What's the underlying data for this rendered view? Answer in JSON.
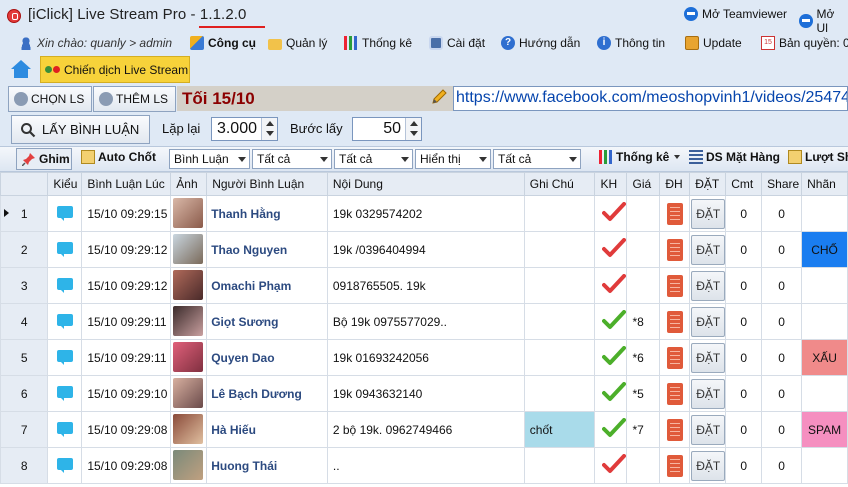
{
  "window": {
    "title": "[iClick] Live Stream Pro - 1.1.2.0",
    "teamviewer": "Mở Teamviewer",
    "ultraview": "Mở Ul"
  },
  "menu": {
    "greeting": "Xin chào: quanly > admin",
    "items": [
      "Công cụ",
      "Quản lý",
      "Thống kê",
      "Cài đặt",
      "Hướng dẫn",
      "Thông tin",
      "Update",
      "Bản quyền: 0"
    ]
  },
  "campaign_tab": "Chiến dịch Live Stream",
  "livestream": {
    "select_label": "CHỌN LS",
    "add_label": "THÊM LS",
    "campaign_name": "Tối 15/10",
    "url": "https://www.facebook.com/meoshopvinh1/videos/25474"
  },
  "fetch": {
    "button_label": "LẤY BÌNH LUẬN",
    "repeat_label": "Lặp lại",
    "repeat_value": "3.000",
    "step_label": "Bước lấy",
    "step_value": "50"
  },
  "toolbar": {
    "pin_label": "Ghim",
    "auto_label": "Auto Chốt",
    "filters": [
      "Bình Luận",
      "Tất cả",
      "Tất cả",
      "Hiển thị",
      "Tất cả"
    ],
    "stats_label": "Thống kê",
    "products_label": "DS Mặt Hàng",
    "share_label": "Lượt Sh"
  },
  "table": {
    "columns": [
      "Kiểu",
      "Bình Luận Lúc",
      "Ảnh",
      "Người Bình Luận",
      "Nội Dung",
      "Ghi Chú",
      "KH",
      "Giá",
      "ĐH",
      "ĐẶT",
      "Cmt",
      "Share",
      "Nhãn"
    ],
    "rows": [
      {
        "n": "1",
        "time": "15/10 09:29:15",
        "name": "Thanh Hằng",
        "content": "19k 0329574202",
        "note": "",
        "kh": "red",
        "gia": "",
        "dat": "ĐẶT",
        "cmt": "0",
        "share": "0",
        "label": "",
        "label_color": ""
      },
      {
        "n": "2",
        "time": "15/10 09:29:12",
        "name": "Thao Nguyen",
        "content": "19k /0396404994",
        "note": "",
        "kh": "red",
        "gia": "",
        "dat": "ĐẶT",
        "cmt": "0",
        "share": "0",
        "label": "CHỐ",
        "label_color": "#1a7df0"
      },
      {
        "n": "3",
        "time": "15/10 09:29:12",
        "name": "Omachi Phạm",
        "content": "0918765505. 19k",
        "note": "",
        "kh": "red",
        "gia": "",
        "dat": "ĐẶT",
        "cmt": "0",
        "share": "0",
        "label": "",
        "label_color": ""
      },
      {
        "n": "4",
        "time": "15/10 09:29:11",
        "name": "Giọt Sương",
        "content": "Bộ 19k 0975577029..",
        "note": "",
        "kh": "green",
        "gia": "*8",
        "dat": "ĐẶT",
        "cmt": "0",
        "share": "0",
        "label": "",
        "label_color": ""
      },
      {
        "n": "5",
        "time": "15/10 09:29:11",
        "name": "Quyen Dao",
        "content": "19k 01693242056",
        "note": "",
        "kh": "green",
        "gia": "*6",
        "dat": "ĐẶT",
        "cmt": "0",
        "share": "0",
        "label": "XẤU",
        "label_color": "#f08a8a"
      },
      {
        "n": "6",
        "time": "15/10 09:29:10",
        "name": "Lê Bạch Dương",
        "content": "19k 0943632140",
        "note": "",
        "kh": "green",
        "gia": "*5",
        "dat": "ĐẶT",
        "cmt": "0",
        "share": "0",
        "label": "",
        "label_color": ""
      },
      {
        "n": "7",
        "time": "15/10 09:29:08",
        "name": "Hà Hiếu",
        "content": "2 bộ 19k. 0962749466",
        "note": "chốt",
        "kh": "green",
        "gia": "*7",
        "dat": "ĐẶT",
        "cmt": "0",
        "share": "0",
        "label": "SPAM",
        "label_color": "#f58fc0"
      },
      {
        "n": "8",
        "time": "15/10 09:29:08",
        "name": "Huong Thái",
        "content": "..",
        "note": "",
        "kh": "red",
        "gia": "",
        "dat": "ĐẶT",
        "cmt": "0",
        "share": "0",
        "label": "",
        "label_color": ""
      }
    ]
  },
  "colors": {
    "check_red": "#e03b3b",
    "check_green": "#4caf2a",
    "campaign_bg": "#f7d23a",
    "note_bg": "#a9dbea"
  }
}
